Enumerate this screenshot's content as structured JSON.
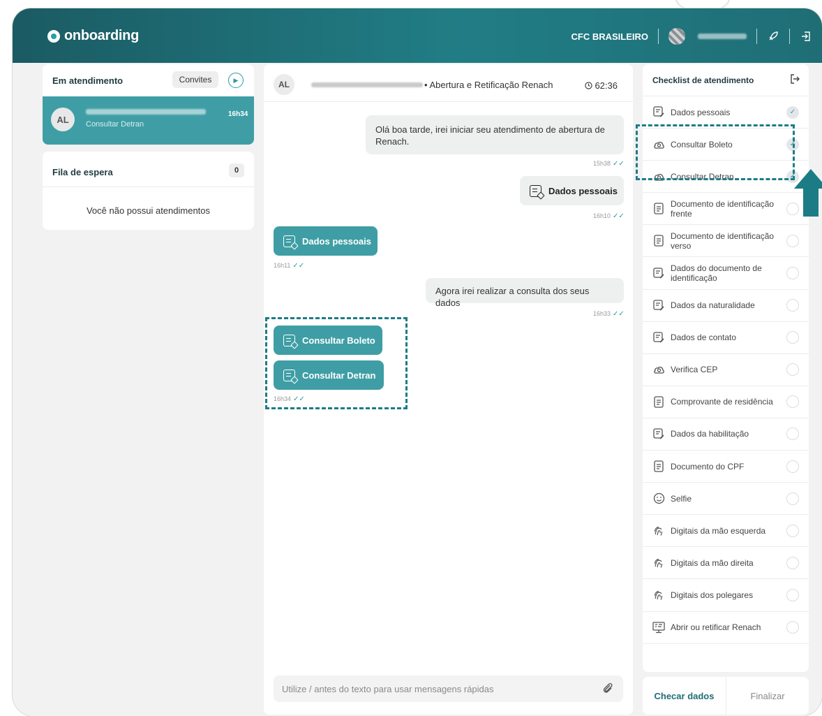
{
  "header": {
    "logo_text": "onboarding",
    "company": "CFC BRASILEIRO"
  },
  "left": {
    "active_title": "Em atendimento",
    "invites_label": "Convites",
    "active_chat": {
      "initials": "AL",
      "subtitle": "Consultar Detran",
      "time": "16h34"
    },
    "queue_title": "Fila de espera",
    "queue_count": "0",
    "queue_empty": "Você não possui atendimentos"
  },
  "chat": {
    "initials": "AL",
    "service": "• Abertura e Retificação Renach",
    "timer": "62:36",
    "messages": [
      {
        "text": "Olá boa tarde, irei iniciar seu atendimento de abertura de Renach.",
        "time": "15h38"
      },
      {
        "text": "Dados pessoais",
        "time": "16h10"
      },
      {
        "text": "Dados pessoais",
        "time": "16h11"
      },
      {
        "text": "Agora irei realizar a consulta dos seus dados",
        "time": "16h33"
      },
      {
        "text": "Consultar Boleto",
        "time": ""
      },
      {
        "text": "Consultar Detran",
        "time": "16h34"
      }
    ],
    "input_placeholder": "Utilize / antes do texto para usar mensagens rápidas"
  },
  "checklist": {
    "title": "Checklist de atendimento",
    "items": [
      {
        "label": "Dados pessoais",
        "icon": "form-icon",
        "done": true
      },
      {
        "label": "Consultar Boleto",
        "icon": "cloud-search-icon",
        "done": true
      },
      {
        "label": "Consultar Detran",
        "icon": "cloud-search-icon",
        "done": true
      },
      {
        "label": "Documento de identificação frente",
        "icon": "document-icon",
        "done": false
      },
      {
        "label": "Documento de identificação verso",
        "icon": "document-icon",
        "done": false
      },
      {
        "label": "Dados do documento de identificação",
        "icon": "form-icon",
        "done": false
      },
      {
        "label": "Dados da naturalidade",
        "icon": "form-icon",
        "done": false
      },
      {
        "label": "Dados de contato",
        "icon": "form-icon",
        "done": false
      },
      {
        "label": "Verifica CEP",
        "icon": "cloud-search-icon",
        "done": false
      },
      {
        "label": "Comprovante de residência",
        "icon": "document-icon",
        "done": false
      },
      {
        "label": "Dados da habilitação",
        "icon": "form-icon",
        "done": false
      },
      {
        "label": "Documento do CPF",
        "icon": "document-icon",
        "done": false
      },
      {
        "label": "Selfie",
        "icon": "smile-icon",
        "done": false
      },
      {
        "label": "Digitais da mão esquerda",
        "icon": "fingerprint-icon",
        "done": false
      },
      {
        "label": "Digitais da mão direita",
        "icon": "fingerprint-icon",
        "done": false
      },
      {
        "label": "Digitais dos polegares",
        "icon": "fingerprint-icon",
        "done": false
      },
      {
        "label": "Abrir ou retificar Renach",
        "icon": "terminal-icon",
        "done": false
      }
    ],
    "check_button": "Checar dados",
    "finish_button": "Finalizar"
  },
  "colors": {
    "brand": "#217d85",
    "accent": "#3f9ea5",
    "highlight": "#1c7c86"
  }
}
